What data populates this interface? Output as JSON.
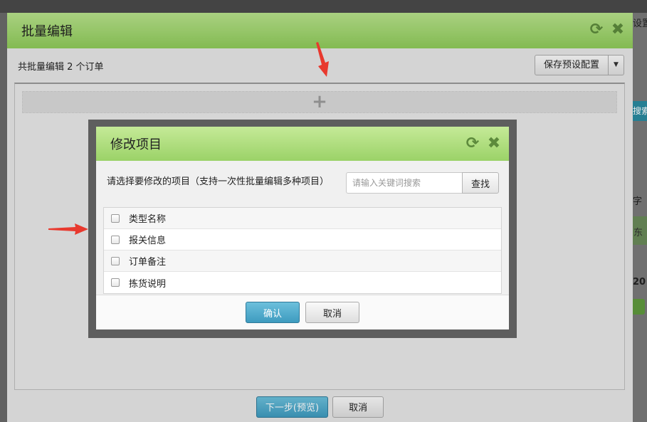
{
  "background": {
    "right_texts": [
      "设置",
      "搜索",
      "字",
      "东",
      "20"
    ]
  },
  "outer_dialog": {
    "title": "批量编辑",
    "order_count_text": "共批量编辑 2 个订单",
    "save_preset_label": "保存预设配置",
    "add_symbol": "+",
    "next_label": "下一步(预览)",
    "cancel_label": "取消"
  },
  "inner_dialog": {
    "title": "修改项目",
    "prompt": "请选择要修改的项目（支持一次性批量编辑多种项目）",
    "search_placeholder": "请输入关键词搜索",
    "search_button": "查找",
    "items": [
      {
        "label": "类型名称",
        "checked": false
      },
      {
        "label": "报关信息",
        "checked": false
      },
      {
        "label": "订单备注",
        "checked": false
      },
      {
        "label": "拣货说明",
        "checked": false
      }
    ],
    "confirm_label": "确认",
    "cancel_label": "取消"
  },
  "colors": {
    "header_green": "#9bd268",
    "primary_blue": "#3e9bbf",
    "arrow_red": "#e8392e"
  },
  "icons": {
    "refresh": "refresh-icon",
    "close": "close-icon"
  }
}
